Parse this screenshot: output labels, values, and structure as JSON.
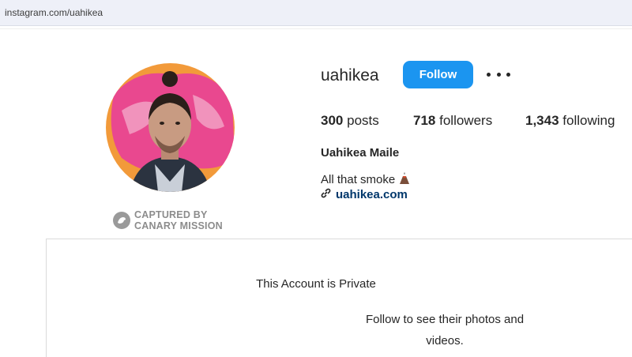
{
  "browser": {
    "url": "instagram.com/uahikea"
  },
  "profile": {
    "username": "uahikea",
    "follow_label": "Follow",
    "posts_count": "300",
    "posts_label": "posts",
    "followers_count": "718",
    "followers_label": "followers",
    "following_count": "1,343",
    "following_label": "following",
    "full_name": "Uahikea Maile",
    "bio": "All that smoke",
    "bio_emoji": "volcano-icon",
    "link": "uahikea.com"
  },
  "watermark": {
    "line1": "CAPTURED BY",
    "line2": "CANARY MISSION"
  },
  "private": {
    "title": "This Account is Private",
    "subtitle": "Follow to see their photos and videos."
  },
  "colors": {
    "follow_button": "#1b95f0",
    "link": "#00376b",
    "avatar_pink": "#e9488f",
    "avatar_orange": "#f29a3a"
  }
}
